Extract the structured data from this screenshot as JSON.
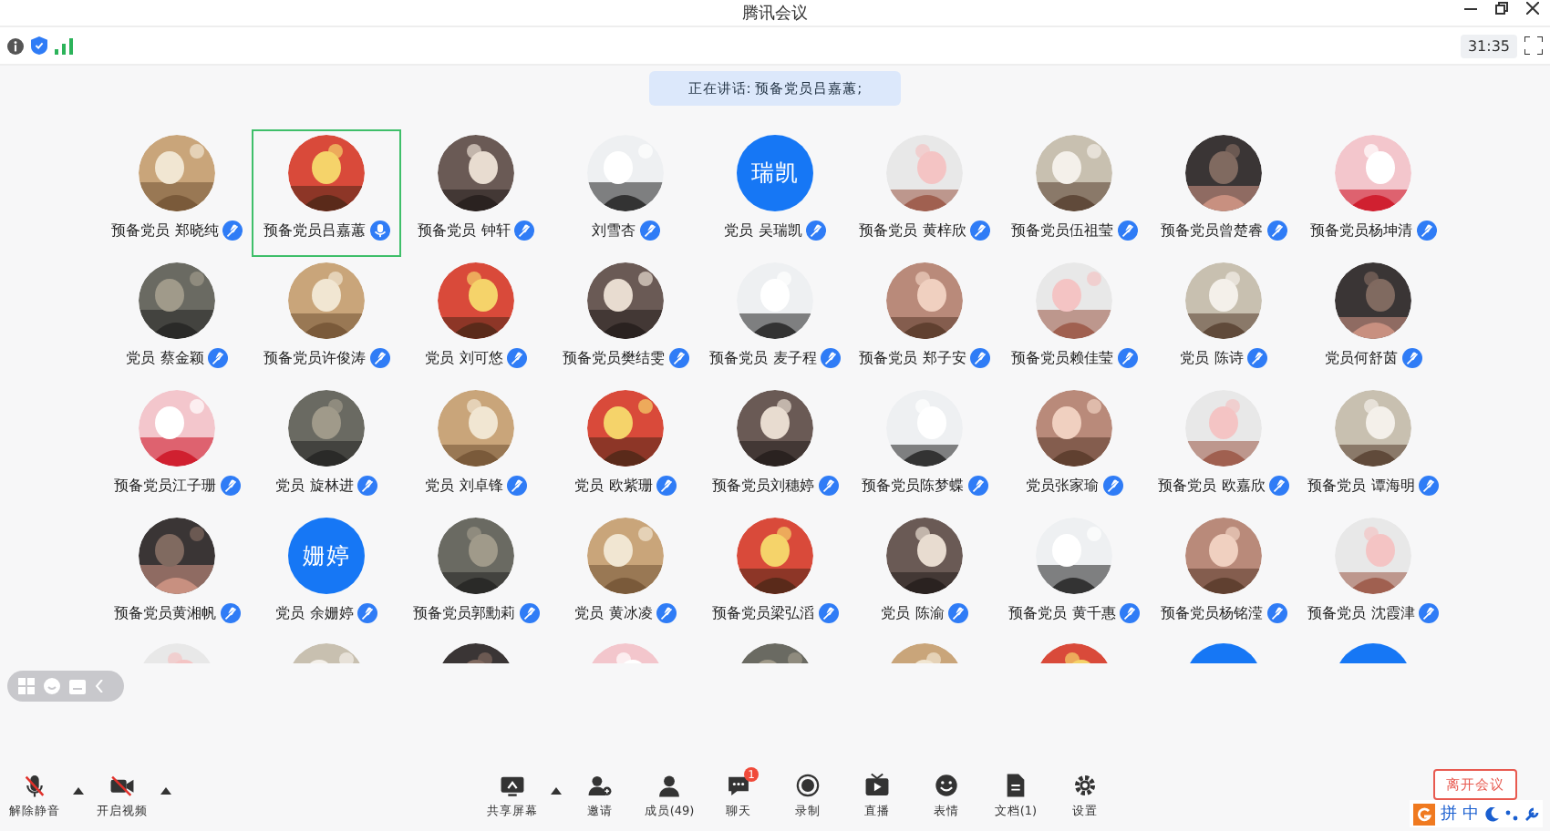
{
  "window": {
    "title": "腾讯会议"
  },
  "info_bar": {
    "timer": "31:35"
  },
  "speaker_banner": "正在讲话: 预备党员吕嘉蕙;",
  "participants": [
    {
      "name": "预备党员 郑晓纯",
      "kind": "picture",
      "selected": false,
      "speaking": false
    },
    {
      "name": "预备党员吕嘉蕙",
      "kind": "picture",
      "selected": true,
      "speaking": true
    },
    {
      "name": "预备党员 钟轩",
      "kind": "picture",
      "selected": false,
      "speaking": false
    },
    {
      "name": "刘雪杏",
      "kind": "picture",
      "selected": false,
      "speaking": false
    },
    {
      "name": "党员 吴瑞凯",
      "kind": "text",
      "avatar_text": "瑞凯",
      "selected": false,
      "speaking": false
    },
    {
      "name": "预备党员 黄梓欣",
      "kind": "picture",
      "selected": false,
      "speaking": false
    },
    {
      "name": "预备党员伍祖莹",
      "kind": "picture",
      "selected": false,
      "speaking": false
    },
    {
      "name": "预备党员曾楚睿",
      "kind": "picture",
      "selected": false,
      "speaking": false
    },
    {
      "name": "预备党员杨坤清",
      "kind": "picture",
      "selected": false,
      "speaking": false
    },
    {
      "name": "党员 蔡金颖",
      "kind": "picture",
      "selected": false,
      "speaking": false
    },
    {
      "name": "预备党员许俊涛",
      "kind": "picture",
      "selected": false,
      "speaking": false
    },
    {
      "name": "党员 刘可悠",
      "kind": "picture",
      "selected": false,
      "speaking": false
    },
    {
      "name": "预备党员樊结雯",
      "kind": "picture",
      "selected": false,
      "speaking": false
    },
    {
      "name": "预备党员 麦子程",
      "kind": "picture",
      "selected": false,
      "speaking": false
    },
    {
      "name": "预备党员 郑子安",
      "kind": "picture",
      "selected": false,
      "speaking": false
    },
    {
      "name": "预备党员赖佳莹",
      "kind": "picture",
      "selected": false,
      "speaking": false
    },
    {
      "name": "党员 陈诗",
      "kind": "picture",
      "selected": false,
      "speaking": false
    },
    {
      "name": "党员何舒茵",
      "kind": "picture",
      "selected": false,
      "speaking": false
    },
    {
      "name": "预备党员江子珊",
      "kind": "picture",
      "selected": false,
      "speaking": false
    },
    {
      "name": "党员 旋林进",
      "kind": "picture",
      "selected": false,
      "speaking": false
    },
    {
      "name": "党员 刘卓锋",
      "kind": "picture",
      "selected": false,
      "speaking": false
    },
    {
      "name": "党员 欧紫珊",
      "kind": "picture",
      "selected": false,
      "speaking": false
    },
    {
      "name": "预备党员刘穗婷",
      "kind": "picture",
      "selected": false,
      "speaking": false
    },
    {
      "name": "预备党员陈梦蝶",
      "kind": "picture",
      "selected": false,
      "speaking": false
    },
    {
      "name": "党员张家瑜",
      "kind": "picture",
      "selected": false,
      "speaking": false
    },
    {
      "name": "预备党员 欧嘉欣",
      "kind": "picture",
      "selected": false,
      "speaking": false
    },
    {
      "name": "预备党员 谭海明",
      "kind": "picture",
      "selected": false,
      "speaking": false
    },
    {
      "name": "预备党员黄湘帆",
      "kind": "picture",
      "selected": false,
      "speaking": false
    },
    {
      "name": "党员 余姗婷",
      "kind": "text",
      "avatar_text": "姗婷",
      "selected": false,
      "speaking": false
    },
    {
      "name": "预备党员郭勳莉",
      "kind": "picture",
      "selected": false,
      "speaking": false
    },
    {
      "name": "党员 黄冰凌",
      "kind": "picture",
      "selected": false,
      "speaking": false
    },
    {
      "name": "预备党员梁弘滔",
      "kind": "picture",
      "selected": false,
      "speaking": false
    },
    {
      "name": "党员 陈渝",
      "kind": "picture",
      "selected": false,
      "speaking": false
    },
    {
      "name": "预备党员 黄千惠",
      "kind": "picture",
      "selected": false,
      "speaking": false
    },
    {
      "name": "预备党员杨铭滢",
      "kind": "picture",
      "selected": false,
      "speaking": false
    },
    {
      "name": "预备党员 沈霞津",
      "kind": "picture",
      "selected": false,
      "speaking": false
    }
  ],
  "partial_row": [
    {
      "kind": "picture"
    },
    {
      "kind": "picture"
    },
    {
      "kind": "picture"
    },
    {
      "kind": "picture"
    },
    {
      "kind": "picture"
    },
    {
      "kind": "picture"
    },
    {
      "kind": "picture"
    },
    {
      "kind": "plain"
    },
    {
      "kind": "plain"
    }
  ],
  "toolbar_left": [
    {
      "label": "解除静音",
      "caret": true
    },
    {
      "label": "开启视频",
      "caret": true
    }
  ],
  "toolbar_center": [
    {
      "label": "共享屏幕",
      "caret": true
    },
    {
      "label": "邀请",
      "caret": false
    },
    {
      "label": "成员(49)",
      "caret": false
    },
    {
      "label": "聊天",
      "caret": false,
      "badge": "1"
    },
    {
      "label": "录制",
      "caret": false
    },
    {
      "label": "直播",
      "caret": false
    },
    {
      "label": "表情",
      "caret": false
    },
    {
      "label": "文档(1)",
      "caret": false
    },
    {
      "label": "设置",
      "caret": false
    }
  ],
  "leave_button": "离开会议",
  "ime_bar": [
    "拼",
    "中"
  ]
}
